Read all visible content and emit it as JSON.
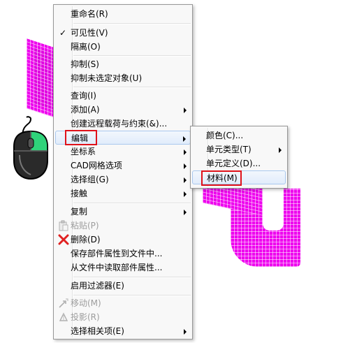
{
  "context_menu": {
    "items": [
      {
        "label": "重命名(R)"
      },
      {
        "label": "可见性(V)",
        "checked": true
      },
      {
        "label": "隔离(O)"
      },
      {
        "label": "抑制(S)"
      },
      {
        "label": "抑制未选定对象(U)"
      },
      {
        "label": "查询(I)"
      },
      {
        "label": "添加(A)",
        "submenu": true
      },
      {
        "label": "创建远程载荷与约束(&)..."
      },
      {
        "label": "编辑",
        "submenu": true,
        "highlighted": true
      },
      {
        "label": "坐标系",
        "submenu": true
      },
      {
        "label": "CAD网格选项",
        "submenu": true
      },
      {
        "label": "选择组(G)",
        "submenu": true
      },
      {
        "label": "接触",
        "submenu": true
      },
      {
        "label": "复制",
        "submenu": true
      },
      {
        "label": "粘贴(P)",
        "disabled": true
      },
      {
        "label": "删除(D)"
      },
      {
        "label": "保存部件属性到文件中..."
      },
      {
        "label": "从文件中读取部件属性..."
      },
      {
        "label": "启用过滤器(E)"
      },
      {
        "label": "移动(M)",
        "disabled": true
      },
      {
        "label": "投影(R)",
        "disabled": true
      },
      {
        "label": "选择相关项(E)",
        "submenu": true
      }
    ]
  },
  "edit_submenu": {
    "items": [
      {
        "label": "颜色(C)..."
      },
      {
        "label": "单元类型(T)",
        "submenu": true
      },
      {
        "label": "单元定义(D)..."
      },
      {
        "label": "材料(M)",
        "highlighted": true
      }
    ]
  },
  "colors": {
    "mesh": "#ee00ee",
    "highlight_box": "#e0121a",
    "mouse_button": "#2fd37a"
  },
  "icons": {
    "checkmark": "check-icon",
    "paste": "paste-icon",
    "delete": "delete-x-icon",
    "move": "move-icon",
    "project": "project-icon",
    "mouse": "mouse-icon"
  }
}
